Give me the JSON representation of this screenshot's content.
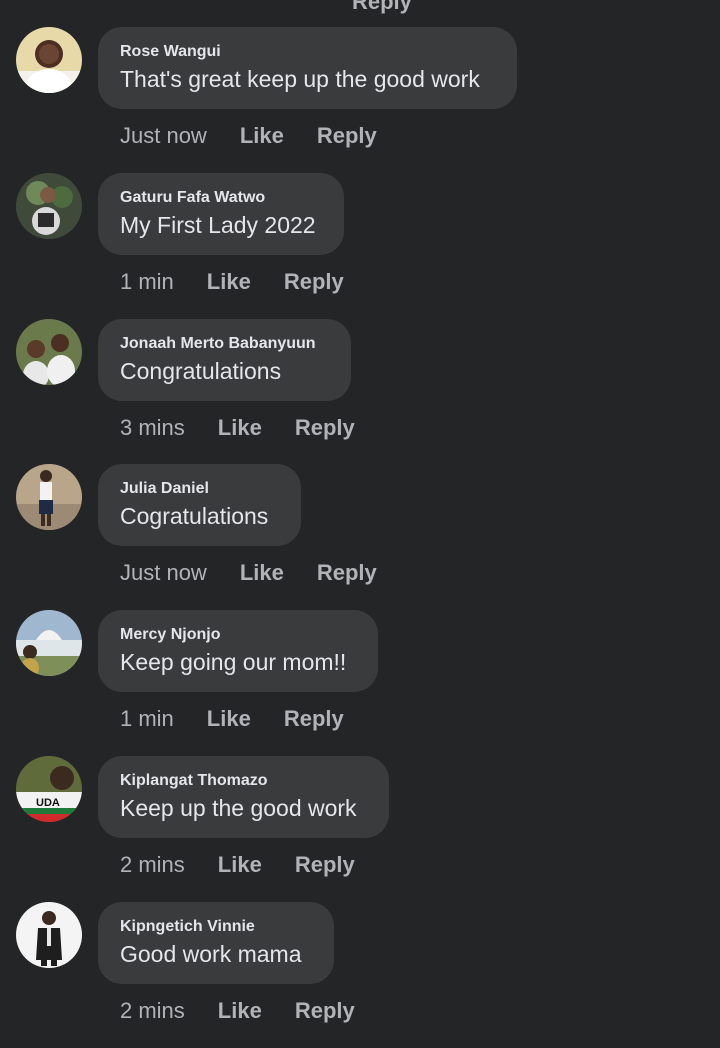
{
  "top_cutoff_label": "Reply",
  "colors": {
    "background": "#242526",
    "bubble": "#3a3b3c",
    "primary_text": "#e4e6eb",
    "secondary_text": "#b0b3b8"
  },
  "comments": [
    {
      "author": "Rose Wangui",
      "text": "That's great keep up the good work",
      "time": "Just now",
      "like_label": "Like",
      "reply_label": "Reply"
    },
    {
      "author": "Gaturu Fafa Watwo",
      "text": "My First Lady 2022",
      "time": "1 min",
      "like_label": "Like",
      "reply_label": "Reply"
    },
    {
      "author": "Jonaah Merto Babanyuun",
      "text": "Congratulations",
      "time": "3 mins",
      "like_label": "Like",
      "reply_label": "Reply"
    },
    {
      "author": "Julia Daniel",
      "text": "Cogratulations",
      "time": "Just now",
      "like_label": "Like",
      "reply_label": "Reply"
    },
    {
      "author": "Mercy Njonjo",
      "text": "Keep going our mom!!",
      "time": "1 min",
      "like_label": "Like",
      "reply_label": "Reply"
    },
    {
      "author": "Kiplangat Thomazo",
      "text": "Keep up the good work",
      "time": "2 mins",
      "like_label": "Like",
      "reply_label": "Reply",
      "avatar_badge": "UDA"
    },
    {
      "author": "Kipngetich Vinnie",
      "text": "Good work mama",
      "time": "2 mins",
      "like_label": "Like",
      "reply_label": "Reply"
    }
  ]
}
